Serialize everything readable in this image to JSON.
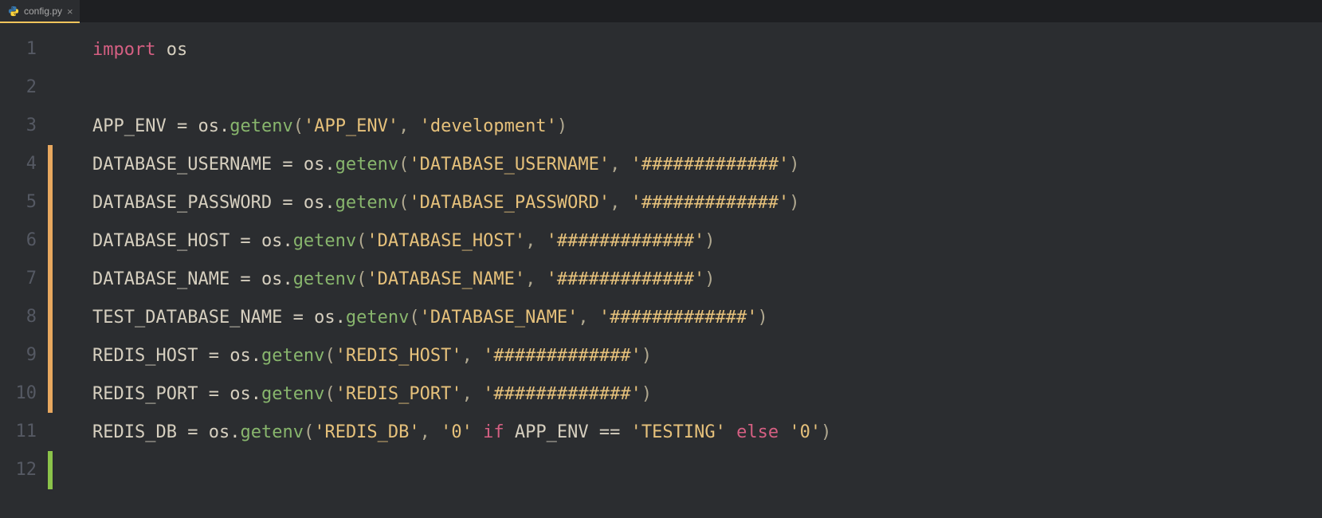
{
  "tab": {
    "filename": "config.py",
    "close_glyph": "×"
  },
  "gutter": [
    "1",
    "2",
    "3",
    "4",
    "5",
    "6",
    "7",
    "8",
    "9",
    "10",
    "11",
    "12"
  ],
  "diff_markers": [
    "",
    "",
    "",
    "mod",
    "mod",
    "mod",
    "mod",
    "mod",
    "mod",
    "mod",
    "",
    "add"
  ],
  "code": {
    "l1": {
      "kw": "import",
      "sp": " ",
      "mod": "os"
    },
    "l2": {},
    "l3": {
      "id": "APP_ENV",
      "eq": " = ",
      "obj": "os",
      "dot": ".",
      "fn": "getenv",
      "op": "(",
      "s1": "'APP_ENV'",
      "cm": ", ",
      "s2": "'development'",
      "cp": ")"
    },
    "l4": {
      "id": "DATABASE_USERNAME",
      "eq": " = ",
      "obj": "os",
      "dot": ".",
      "fn": "getenv",
      "op": "(",
      "s1": "'DATABASE_USERNAME'",
      "cm": ", ",
      "s2": "'#############'",
      "cp": ")"
    },
    "l5": {
      "id": "DATABASE_PASSWORD",
      "eq": " = ",
      "obj": "os",
      "dot": ".",
      "fn": "getenv",
      "op": "(",
      "s1": "'DATABASE_PASSWORD'",
      "cm": ", ",
      "s2": "'#############'",
      "cp": ")"
    },
    "l6": {
      "id": "DATABASE_HOST",
      "eq": " = ",
      "obj": "os",
      "dot": ".",
      "fn": "getenv",
      "op": "(",
      "s1": "'DATABASE_HOST'",
      "cm": ", ",
      "s2": "'#############'",
      "cp": ")"
    },
    "l7": {
      "id": "DATABASE_NAME",
      "eq": " = ",
      "obj": "os",
      "dot": ".",
      "fn": "getenv",
      "op": "(",
      "s1": "'DATABASE_NAME'",
      "cm": ", ",
      "s2": "'#############'",
      "cp": ")"
    },
    "l8": {
      "id": "TEST_DATABASE_NAME",
      "eq": " = ",
      "obj": "os",
      "dot": ".",
      "fn": "getenv",
      "op": "(",
      "s1": "'DATABASE_NAME'",
      "cm": ", ",
      "s2": "'#############'",
      "cp": ")"
    },
    "l9": {
      "id": "REDIS_HOST",
      "eq": " = ",
      "obj": "os",
      "dot": ".",
      "fn": "getenv",
      "op": "(",
      "s1": "'REDIS_HOST'",
      "cm": ", ",
      "s2": "'#############'",
      "cp": ")"
    },
    "l10": {
      "id": "REDIS_PORT",
      "eq": " = ",
      "obj": "os",
      "dot": ".",
      "fn": "getenv",
      "op": "(",
      "s1": "'REDIS_PORT'",
      "cm": ", ",
      "s2": "'#############'",
      "cp": ")"
    },
    "l11": {
      "id": "REDIS_DB",
      "eq": " = ",
      "obj": "os",
      "dot": ".",
      "fn": "getenv",
      "op": "(",
      "s1": "'REDIS_DB'",
      "cm": ", ",
      "s2": "'0'",
      "sp1": " ",
      "kw1": "if",
      "sp2": " ",
      "id2": "APP_ENV",
      "sp3": " ",
      "opq": "==",
      "sp4": " ",
      "s3": "'TESTING'",
      "sp5": " ",
      "kw2": "else",
      "sp6": " ",
      "s4": "'0'",
      "cp": ")"
    },
    "l12": {}
  }
}
